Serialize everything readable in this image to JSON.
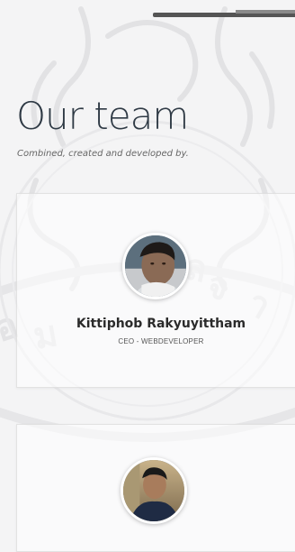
{
  "header": {
    "title": "Our team",
    "subtitle": "Combined, created and developed by."
  },
  "team": [
    {
      "name": "Kittiphob Rakyuyittham",
      "role": "CEO - WEBDEVELOPER"
    },
    {
      "name": "",
      "role": ""
    }
  ],
  "colors": {
    "background": "#f4f4f5",
    "title": "#2f3a45",
    "card": "#ffffff",
    "top_bar": "#555555"
  }
}
